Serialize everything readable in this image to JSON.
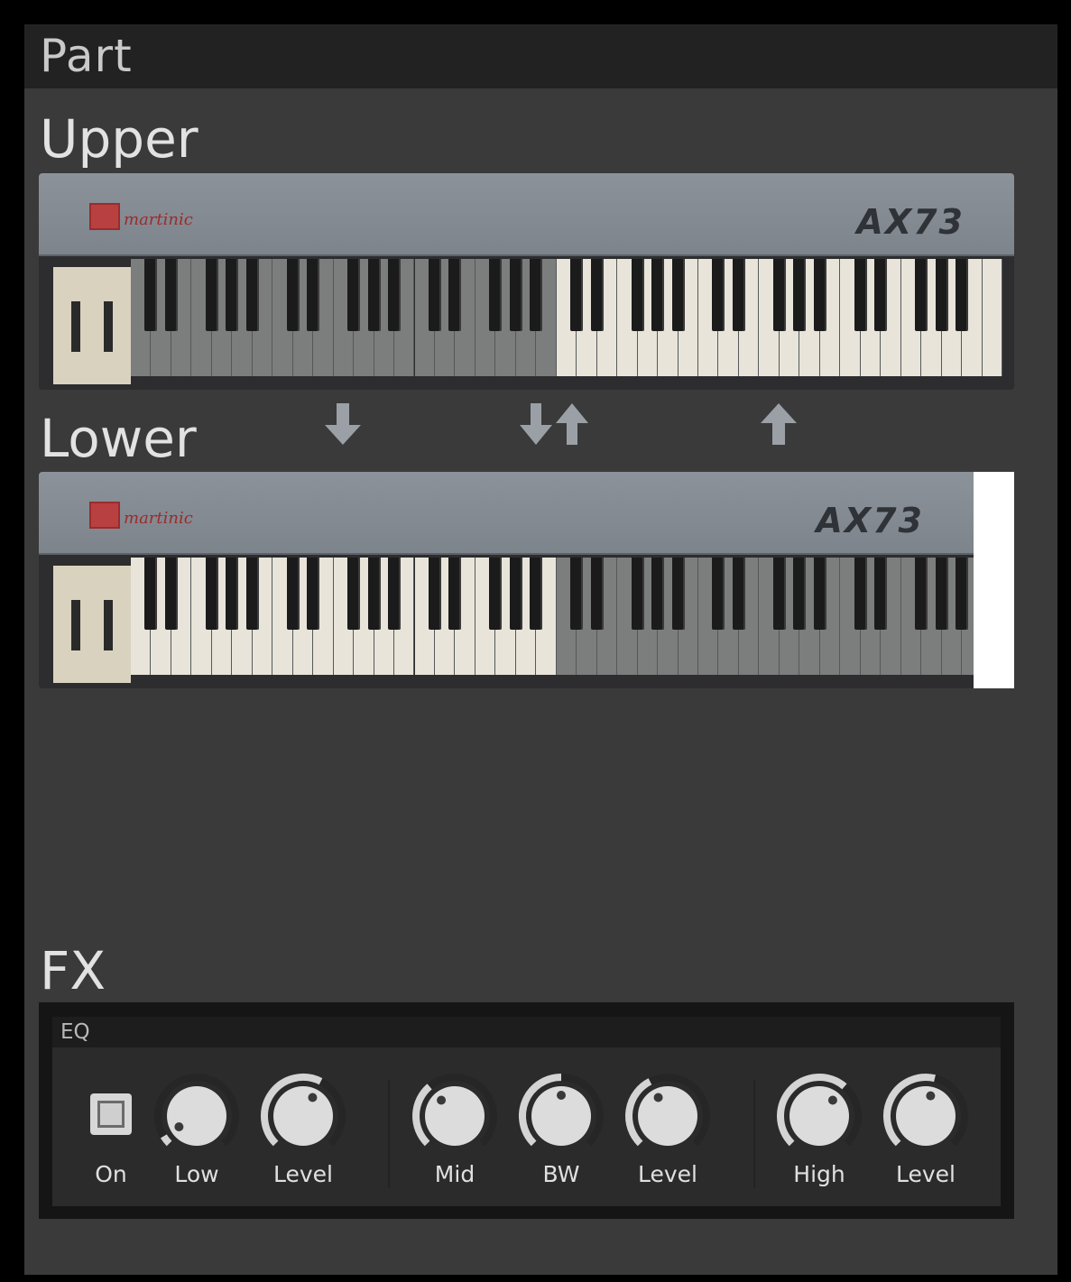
{
  "panel": {
    "title": "Part"
  },
  "upper": {
    "title": "Upper",
    "brand": "martinic",
    "model": "AX73"
  },
  "lower": {
    "title": "Lower",
    "brand": "martinic",
    "model": "AX73"
  },
  "arrows": {
    "down": "down-arrow-icon",
    "swap": "swap-arrows-icon",
    "up": "up-arrow-icon"
  },
  "fx": {
    "title": "FX",
    "eq": {
      "title": "EQ",
      "on_label": "On",
      "knobs": [
        {
          "label": "Low",
          "value": 0.05
        },
        {
          "label": "Level",
          "value": 0.6
        },
        {
          "label": "Mid",
          "value": 0.35
        },
        {
          "label": "BW",
          "value": 0.5
        },
        {
          "label": "Level",
          "value": 0.4
        },
        {
          "label": "High",
          "value": 0.65
        },
        {
          "label": "Level",
          "value": 0.55
        }
      ]
    }
  },
  "colors": {
    "panel_bg": "#3a3a3a",
    "header_bg": "#222222",
    "key_white_active": "#e8e4da",
    "key_white_inactive": "#7c7d7d",
    "arrow": "#9aa0a6"
  }
}
